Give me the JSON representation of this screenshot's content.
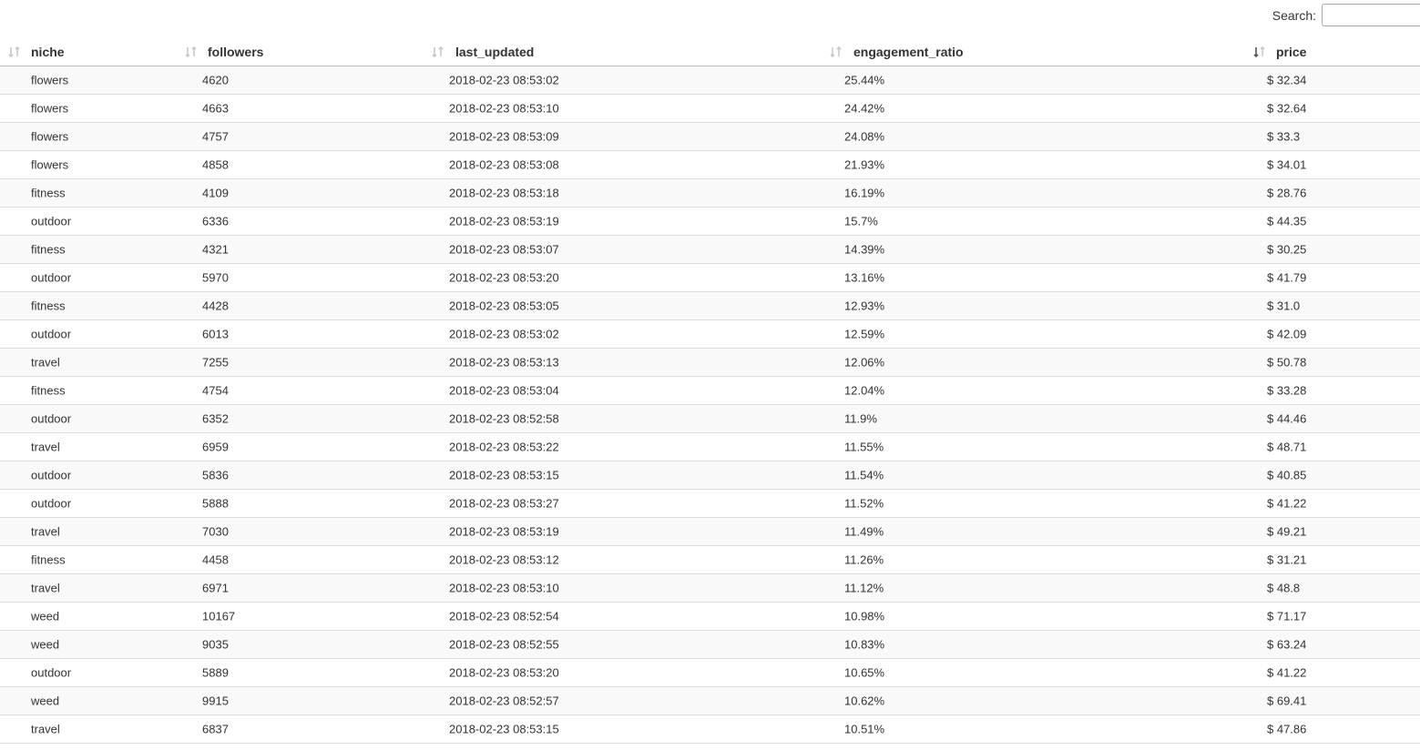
{
  "search": {
    "label": "Search:",
    "value": "",
    "placeholder": ""
  },
  "table": {
    "columns": [
      {
        "key": "niche",
        "label": "niche",
        "sort": "none"
      },
      {
        "key": "followers",
        "label": "followers",
        "sort": "none"
      },
      {
        "key": "last_updated",
        "label": "last_updated",
        "sort": "none"
      },
      {
        "key": "engagement_ratio",
        "label": "engagement_ratio",
        "sort": "none"
      },
      {
        "key": "price",
        "label": "price",
        "sort": "active"
      }
    ],
    "rows": [
      [
        "flowers",
        "4620",
        "2018-02-23 08:53:02",
        "25.44%",
        "$ 32.34"
      ],
      [
        "flowers",
        "4663",
        "2018-02-23 08:53:10",
        "24.42%",
        "$ 32.64"
      ],
      [
        "flowers",
        "4757",
        "2018-02-23 08:53:09",
        "24.08%",
        "$ 33.3"
      ],
      [
        "flowers",
        "4858",
        "2018-02-23 08:53:08",
        "21.93%",
        "$ 34.01"
      ],
      [
        "fitness",
        "4109",
        "2018-02-23 08:53:18",
        "16.19%",
        "$ 28.76"
      ],
      [
        "outdoor",
        "6336",
        "2018-02-23 08:53:19",
        "15.7%",
        "$ 44.35"
      ],
      [
        "fitness",
        "4321",
        "2018-02-23 08:53:07",
        "14.39%",
        "$ 30.25"
      ],
      [
        "outdoor",
        "5970",
        "2018-02-23 08:53:20",
        "13.16%",
        "$ 41.79"
      ],
      [
        "fitness",
        "4428",
        "2018-02-23 08:53:05",
        "12.93%",
        "$ 31.0"
      ],
      [
        "outdoor",
        "6013",
        "2018-02-23 08:53:02",
        "12.59%",
        "$ 42.09"
      ],
      [
        "travel",
        "7255",
        "2018-02-23 08:53:13",
        "12.06%",
        "$ 50.78"
      ],
      [
        "fitness",
        "4754",
        "2018-02-23 08:53:04",
        "12.04%",
        "$ 33.28"
      ],
      [
        "outdoor",
        "6352",
        "2018-02-23 08:52:58",
        "11.9%",
        "$ 44.46"
      ],
      [
        "travel",
        "6959",
        "2018-02-23 08:53:22",
        "11.55%",
        "$ 48.71"
      ],
      [
        "outdoor",
        "5836",
        "2018-02-23 08:53:15",
        "11.54%",
        "$ 40.85"
      ],
      [
        "outdoor",
        "5888",
        "2018-02-23 08:53:27",
        "11.52%",
        "$ 41.22"
      ],
      [
        "travel",
        "7030",
        "2018-02-23 08:53:19",
        "11.49%",
        "$ 49.21"
      ],
      [
        "fitness",
        "4458",
        "2018-02-23 08:53:12",
        "11.26%",
        "$ 31.21"
      ],
      [
        "travel",
        "6971",
        "2018-02-23 08:53:10",
        "11.12%",
        "$ 48.8"
      ],
      [
        "weed",
        "10167",
        "2018-02-23 08:52:54",
        "10.98%",
        "$ 71.17"
      ],
      [
        "weed",
        "9035",
        "2018-02-23 08:52:55",
        "10.83%",
        "$ 63.24"
      ],
      [
        "outdoor",
        "5889",
        "2018-02-23 08:53:20",
        "10.65%",
        "$ 41.22"
      ],
      [
        "weed",
        "9915",
        "2018-02-23 08:52:57",
        "10.62%",
        "$ 69.41"
      ],
      [
        "travel",
        "6837",
        "2018-02-23 08:53:15",
        "10.51%",
        "$ 47.86"
      ]
    ]
  },
  "colors": {
    "stripe": "#f9f9f9",
    "row_border": "#dddddd",
    "header_border": "#bcbcbc",
    "sort_icon_inactive": "#c8c8c8",
    "sort_icon_active": "#555555"
  },
  "icons": {
    "sort_inactive": "sort-both-icon",
    "sort_active": "sort-desc-icon"
  }
}
